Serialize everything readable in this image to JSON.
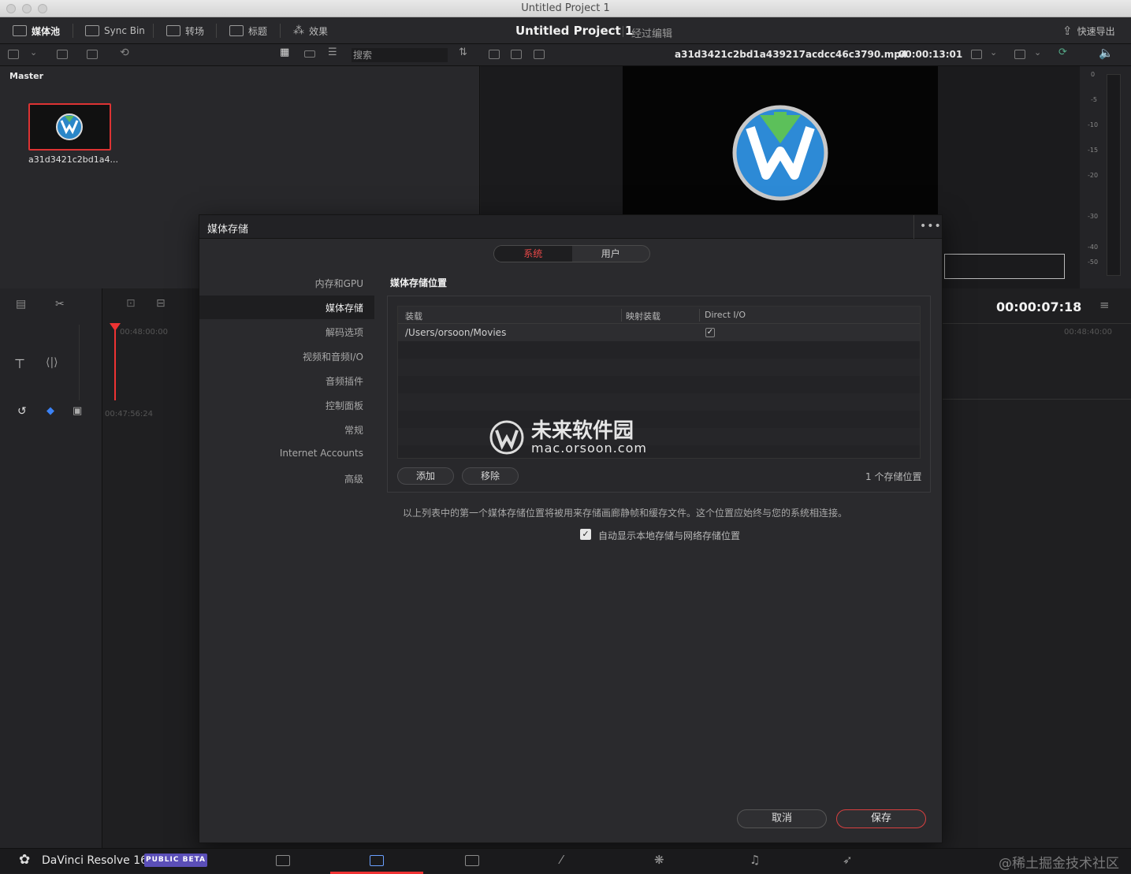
{
  "window": {
    "title": "Untitled Project 1"
  },
  "toolbar": {
    "media_pool": "媒体池",
    "sync_bin": "Sync Bin",
    "transitions": "转场",
    "titles": "标题",
    "effects": "效果",
    "project_title": "Untitled Project 1",
    "project_subtitle": "经过编辑",
    "quick_export": "快速导出"
  },
  "bar2": {
    "search_placeholder": "搜索",
    "clip_name": "a31d3421c2bd1a439217acdcc46c3790.mp4",
    "clip_timecode": "00:00:13:01"
  },
  "media_pool": {
    "bin": "Master",
    "clip_label": "a31d3421c2bd1a4..."
  },
  "meter": {
    "ticks": [
      "0",
      "-5",
      "-10",
      "-15",
      "-20",
      "-30",
      "-40",
      "-50"
    ]
  },
  "timeline": {
    "timecode": "00:00:07:18",
    "start_ts": "00:48:00:00",
    "end_ts": "00:48:40:00",
    "lower_ts": "00:47:56:24"
  },
  "dialog": {
    "title": "媒体存储",
    "more": "•••",
    "tabs": {
      "system": "系统",
      "user": "用户"
    },
    "nav": [
      "内存和GPU",
      "媒体存储",
      "解码选项",
      "视频和音频I/O",
      "音频插件",
      "控制面板",
      "常规",
      "Internet Accounts",
      "高级"
    ],
    "section_title": "媒体存储位置",
    "table": {
      "col_mount": "装载",
      "col_mapped": "映射装载",
      "col_direct": "Direct I/O",
      "row1_path": "/Users/orsoon/Movies",
      "row1_check": "✓"
    },
    "add": "添加",
    "remove": "移除",
    "count": "1 个存储位置",
    "description": "以上列表中的第一个媒体存储位置将被用来存储画廊静帧和缓存文件。这个位置应始终与您的系统相连接。",
    "auto_label": "自动显示本地存储与网络存储位置",
    "auto_check": "✓",
    "cancel": "取消",
    "save": "保存",
    "watermark_cn": "未来软件园",
    "watermark_url": "mac.orsoon.com"
  },
  "bottom": {
    "app_name": "DaVinci Resolve 16",
    "beta": "PUBLIC BETA",
    "credit": "@稀土掘金技术社区"
  },
  "colors": {
    "accent_red": "#e33333",
    "beta_purple": "#5b4fb8"
  }
}
